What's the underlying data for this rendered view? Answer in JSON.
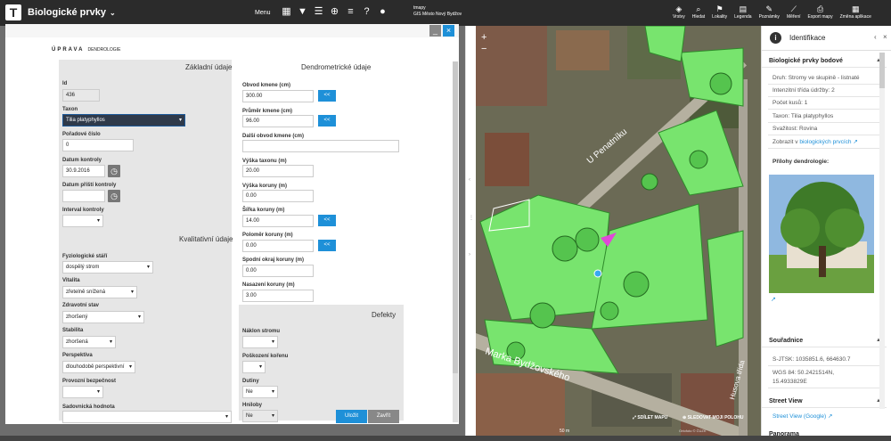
{
  "topbar": {
    "logo": "T",
    "title": "Biologické prvky",
    "menu": "Menu",
    "user_name": "tmapy",
    "user_org": "GIS Město Nový Bydžov"
  },
  "dialog": {
    "upr_main": "ÚPRAVA",
    "upr_sub": "DENDROLOGIE",
    "btn_min": "_",
    "btn_close": "×",
    "sec_basic": "Základní údaje",
    "sec_dendro": "Dendrometrické údaje",
    "sec_quality": "Kvalitativní údaje",
    "sec_defects": "Defekty",
    "save": "Uložit",
    "close": "Zavřít"
  },
  "form": {
    "id": {
      "label": "Id",
      "value": "436"
    },
    "taxon": {
      "label": "Taxon",
      "value": "Tilia platyphyllos"
    },
    "poradove": {
      "label": "Pořadové číslo",
      "value": "0"
    },
    "datum_kontroly": {
      "label": "Datum kontroly",
      "value": "30.9.2016"
    },
    "datum_pristi": {
      "label": "Datum příští kontroly",
      "value": ""
    },
    "interval": {
      "label": "Interval kontroly",
      "value": ""
    },
    "fyziologicke": {
      "label": "Fyziologické stáří",
      "value": "dospělý strom"
    },
    "vitalita": {
      "label": "Vitalita",
      "value": "zřetelně snížená"
    },
    "zdravotni": {
      "label": "Zdravotní stav",
      "value": "zhoršený"
    },
    "stabilita": {
      "label": "Stabilita",
      "value": "zhoršená"
    },
    "perspektiva": {
      "label": "Perspektiva",
      "value": "dlouhodobě perspektivní"
    },
    "provozni": {
      "label": "Provozní bezpečnost",
      "value": ""
    },
    "sadovnicka": {
      "label": "Sadovnická hodnota",
      "value": ""
    },
    "obvod": {
      "label": "Obvod kmene (cm)",
      "value": "300.00"
    },
    "prumer": {
      "label": "Průměr kmene (cm)",
      "value": "96.00"
    },
    "dalsi_obvod": {
      "label": "Další obvod kmene (cm)",
      "value": ""
    },
    "vyska_taxonu": {
      "label": "Výška taxonu (m)",
      "value": "20.00"
    },
    "vyska_koruny": {
      "label": "Výška koruny (m)",
      "value": "0.00"
    },
    "sirka_koruny": {
      "label": "Šířka koruny (m)",
      "value": "14.00"
    },
    "polomer": {
      "label": "Poloměr koruny (m)",
      "value": "0.00"
    },
    "spodni_okraj": {
      "label": "Spodní okraj koruny (m)",
      "value": "0.00"
    },
    "nasazeni": {
      "label": "Nasazení koruny (m)",
      "value": "3.00"
    },
    "naklon": {
      "label": "Náklon stromu",
      "value": ""
    },
    "poskozeni": {
      "label": "Poškození kořenu",
      "value": ""
    },
    "dutiny": {
      "label": "Dutiny",
      "value": "Ne"
    },
    "hniloby": {
      "label": "Hniloby",
      "value": "Ne"
    },
    "copy_btn": "<<"
  },
  "map": {
    "toolbar": [
      "Vrstvy",
      "Hledat",
      "Lokality",
      "Legenda",
      "Poznámky",
      "Měření",
      "Export mapy",
      "Změna aplikace"
    ],
    "street1": "U Penatníku",
    "street2": "Marka Bydžovského",
    "street3": "Husova třída",
    "sdilet": "SDÍLET MAPU",
    "sledovat": "SLEDOVAT MOJI POLOHU",
    "scale": "50 m",
    "attrib": "Ortofoto © ČÚZK"
  },
  "panel": {
    "title": "Identifikace",
    "group": "Biologické prvky bodové",
    "rows": [
      "Druh: Stromy ve skupině - listnaté",
      "Intenzitní třída údržby: 2",
      "Počet kusů: 1",
      "Taxon: Tilia platyphyllos",
      "Svažitost: Rovina"
    ],
    "zobrazit": "Zobrazit v",
    "zobrazit_link": "biologických prvcích",
    "prilohy": "Přílohy dendrologie:",
    "souradnice": "Souřadnice",
    "sjtsk": "S-JTSK: 1035851.6, 664630.7",
    "wgs1": "WGS 84: 50.2421514N,",
    "wgs2": "15.4933829E",
    "street_view": "Street View",
    "street_view_link": "Street View (Google)",
    "panorama": "Panorama"
  },
  "colors": {
    "accent": "#1e90d8",
    "green": "#6fe36a",
    "topbar": "#2b2b2b"
  }
}
